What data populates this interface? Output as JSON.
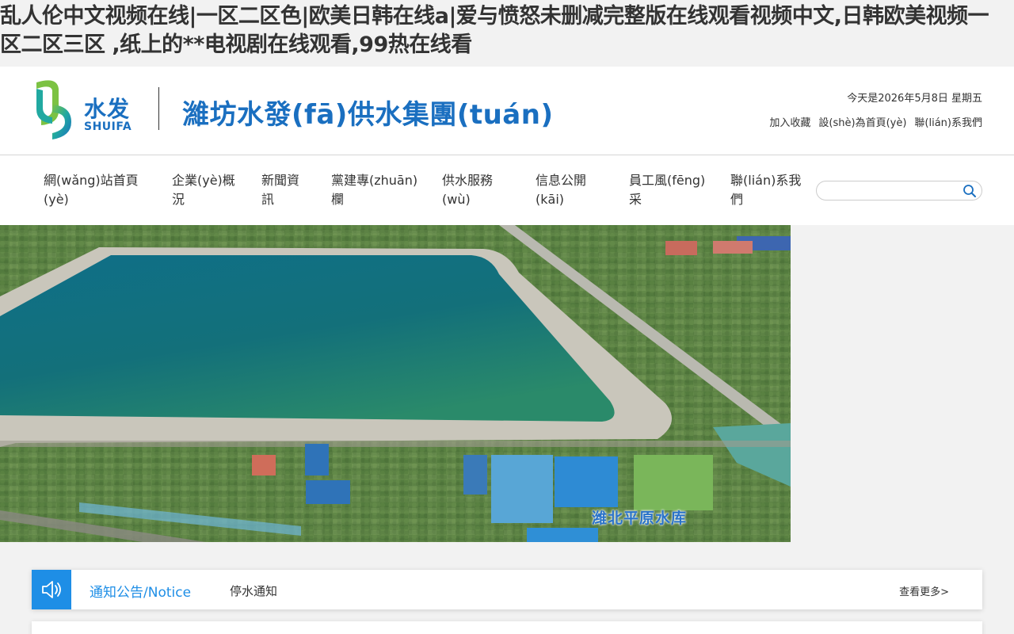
{
  "top_title": "乱人伦中文视频在线|一区二区色|欧美日韩在线a|爱与愤怒未删减完整版在线观看视频中文,日韩欧美视频一区二区三区 ,纸上的**电视剧在线观看,99热在线看",
  "header": {
    "logo_cn": "水发",
    "logo_en": "SHUIFA",
    "site_name": "濰坊水發(fā)供水集團(tuán)",
    "date_text": "今天是2026年5月8日 星期五",
    "quick_links": [
      "加入收藏",
      "設(shè)為首頁(yè)",
      "聯(lián)系我們"
    ]
  },
  "nav": {
    "items": [
      {
        "line1": "網(wǎng)站首頁",
        "line2": "(yè)"
      },
      {
        "line1": "企業(yè)概",
        "line2": "況"
      },
      {
        "line1": "新聞資",
        "line2": "訊"
      },
      {
        "line1": "黨建專(zhuān)",
        "line2": "欄"
      },
      {
        "line1": "供水服務",
        "line2": "(wù)"
      },
      {
        "line1": "信息公開",
        "line2": "(kāi)"
      },
      {
        "line1": "員工風(fēng)",
        "line2": "采"
      },
      {
        "line1": "聯(lián)系我",
        "line2": "們"
      }
    ],
    "search_value": "",
    "search_placeholder": ""
  },
  "banner": {
    "caption": "潍北平原水库"
  },
  "notice": {
    "heading": "通知公告/Notice",
    "item": "停水通知",
    "more": "查看更多>"
  },
  "colors": {
    "brand_blue": "#1a6fc0",
    "notice_blue": "#1e8ee6"
  }
}
